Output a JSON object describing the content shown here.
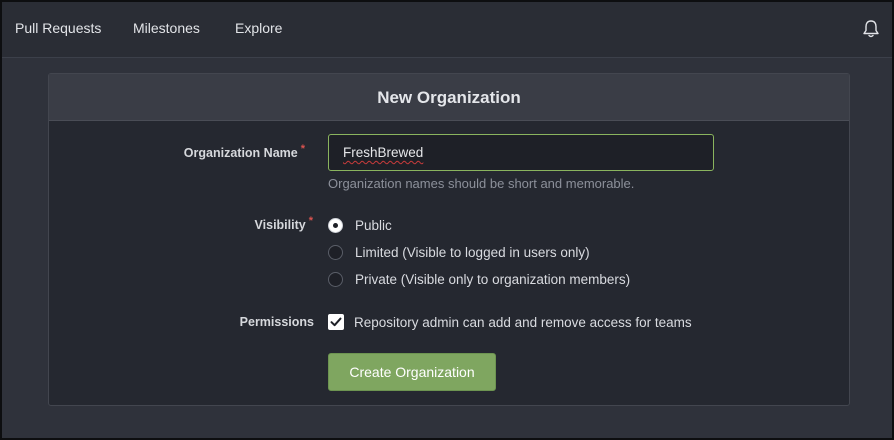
{
  "nav": {
    "items": [
      "Pull Requests",
      "Milestones",
      "Explore"
    ],
    "bell_icon": "bell-icon"
  },
  "form": {
    "title": "New Organization",
    "org_name": {
      "label": "Organization Name",
      "required_mark": "*",
      "value": "FreshBrewed",
      "help": "Organization names should be short and memorable."
    },
    "visibility": {
      "label": "Visibility",
      "required_mark": "*",
      "options": [
        {
          "label": "Public",
          "selected": true
        },
        {
          "label": "Limited (Visible to logged in users only)",
          "selected": false
        },
        {
          "label": "Private (Visible only to organization members)",
          "selected": false
        }
      ]
    },
    "permissions": {
      "label": "Permissions",
      "checkbox_label": "Repository admin can add and remove access for teams",
      "checked": true
    },
    "submit_label": "Create Organization"
  },
  "colors": {
    "accent": "#7fa660",
    "required": "#d9534f",
    "background": "#2f323b"
  }
}
